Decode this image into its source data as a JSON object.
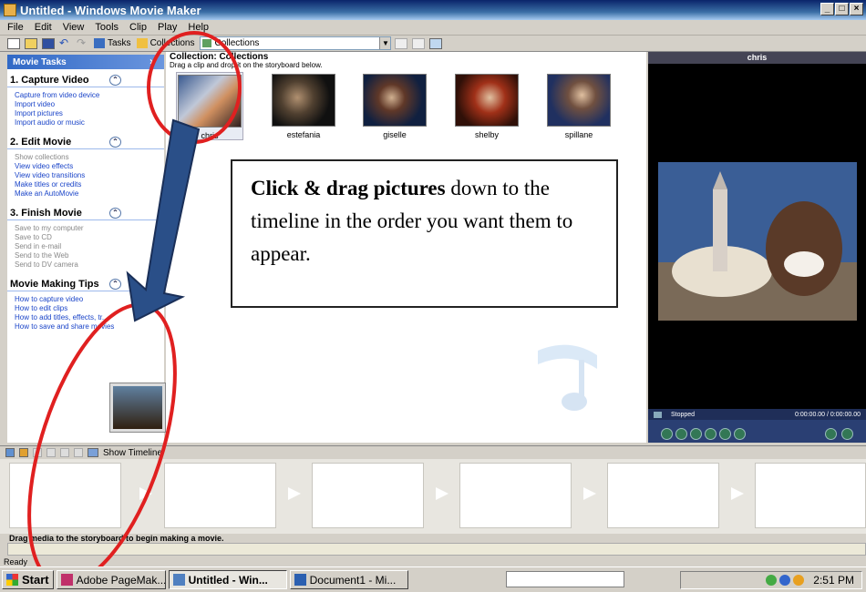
{
  "window": {
    "title": "Untitled - Windows Movie Maker"
  },
  "menu": [
    "File",
    "Edit",
    "View",
    "Tools",
    "Clip",
    "Play",
    "Help"
  ],
  "toolbar": {
    "tasks": "Tasks",
    "collections": "Collections",
    "combo": "Collections"
  },
  "tasks_pane": {
    "header": "Movie Tasks",
    "close": "×",
    "sections": [
      {
        "title": "1. Capture Video",
        "links": [
          "Capture from video device",
          "Import video",
          "Import pictures",
          "Import audio or music"
        ],
        "disabled": false
      },
      {
        "title": "2. Edit Movie",
        "links": [
          "Show collections",
          "View video effects",
          "View video transitions",
          "Make titles or credits",
          "Make an AutoMovie"
        ],
        "disabled": false
      },
      {
        "title": "3. Finish Movie",
        "links": [
          "Save to my computer",
          "Save to CD",
          "Send in e-mail",
          "Send to the Web",
          "Send to DV camera"
        ],
        "disabled": true
      },
      {
        "title": "Movie Making Tips",
        "links": [
          "How to capture video",
          "How to edit clips",
          "How to add titles, effects, tr...",
          "How to save and share movies"
        ],
        "disabled": false
      }
    ]
  },
  "collection": {
    "title": "Collection: Collections",
    "subtitle": "Drag a clip and drop it on the storyboard below.",
    "clips": [
      "chris",
      "estefania",
      "giselle",
      "shelby",
      "spillane"
    ]
  },
  "callout": {
    "bold": "Click & drag pictures",
    "rest": " down to the timeline in the order you want them to appear."
  },
  "monitor": {
    "title": "chris",
    "status": "Stopped",
    "time": "0:00:00.00 / 0:00:00.00"
  },
  "timeline": {
    "toggle": "Show Timeline",
    "frames": 6,
    "message": "Drag media to the storyboard to begin making a movie."
  },
  "status": {
    "text": "Ready"
  },
  "taskbar": {
    "start": "Start",
    "tasks": [
      "Adobe PageMak...",
      "Untitled - Win...",
      "Document1 - Mi..."
    ],
    "clock": "2:51 PM"
  },
  "colors": {
    "titlebar": "#0a246a",
    "link": "#1a44c8",
    "annotation": "#e02020",
    "arrow": "#2a4f88"
  }
}
